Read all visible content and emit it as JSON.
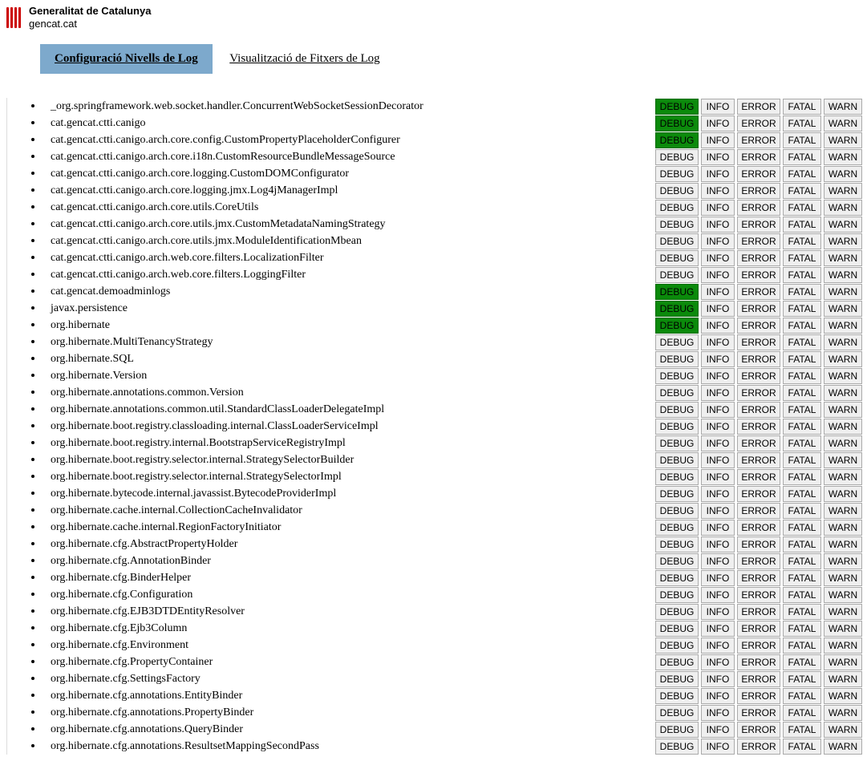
{
  "header": {
    "org_line1": "Generalitat de Catalunya",
    "org_line2": "gencat.cat"
  },
  "tabs": {
    "config": "Configuració Nivells de Log",
    "view": "Visualització de Fitxers de Log"
  },
  "levels": [
    "DEBUG",
    "INFO",
    "ERROR",
    "FATAL",
    "WARN"
  ],
  "loggers": [
    {
      "name": "_org.springframework.web.socket.handler.ConcurrentWebSocketSessionDecorator",
      "active": "DEBUG"
    },
    {
      "name": "cat.gencat.ctti.canigo",
      "active": "DEBUG"
    },
    {
      "name": "cat.gencat.ctti.canigo.arch.core.config.CustomPropertyPlaceholderConfigurer",
      "active": "DEBUG"
    },
    {
      "name": "cat.gencat.ctti.canigo.arch.core.i18n.CustomResourceBundleMessageSource",
      "active": null
    },
    {
      "name": "cat.gencat.ctti.canigo.arch.core.logging.CustomDOMConfigurator",
      "active": null
    },
    {
      "name": "cat.gencat.ctti.canigo.arch.core.logging.jmx.Log4jManagerImpl",
      "active": null
    },
    {
      "name": "cat.gencat.ctti.canigo.arch.core.utils.CoreUtils",
      "active": null
    },
    {
      "name": "cat.gencat.ctti.canigo.arch.core.utils.jmx.CustomMetadataNamingStrategy",
      "active": null
    },
    {
      "name": "cat.gencat.ctti.canigo.arch.core.utils.jmx.ModuleIdentificationMbean",
      "active": null
    },
    {
      "name": "cat.gencat.ctti.canigo.arch.web.core.filters.LocalizationFilter",
      "active": null
    },
    {
      "name": "cat.gencat.ctti.canigo.arch.web.core.filters.LoggingFilter",
      "active": null
    },
    {
      "name": "cat.gencat.demoadminlogs",
      "active": "DEBUG"
    },
    {
      "name": "javax.persistence",
      "active": "DEBUG"
    },
    {
      "name": "org.hibernate",
      "active": "DEBUG"
    },
    {
      "name": "org.hibernate.MultiTenancyStrategy",
      "active": null
    },
    {
      "name": "org.hibernate.SQL",
      "active": null
    },
    {
      "name": "org.hibernate.Version",
      "active": null
    },
    {
      "name": "org.hibernate.annotations.common.Version",
      "active": null
    },
    {
      "name": "org.hibernate.annotations.common.util.StandardClassLoaderDelegateImpl",
      "active": null
    },
    {
      "name": "org.hibernate.boot.registry.classloading.internal.ClassLoaderServiceImpl",
      "active": null
    },
    {
      "name": "org.hibernate.boot.registry.internal.BootstrapServiceRegistryImpl",
      "active": null
    },
    {
      "name": "org.hibernate.boot.registry.selector.internal.StrategySelectorBuilder",
      "active": null
    },
    {
      "name": "org.hibernate.boot.registry.selector.internal.StrategySelectorImpl",
      "active": null
    },
    {
      "name": "org.hibernate.bytecode.internal.javassist.BytecodeProviderImpl",
      "active": null
    },
    {
      "name": "org.hibernate.cache.internal.CollectionCacheInvalidator",
      "active": null
    },
    {
      "name": "org.hibernate.cache.internal.RegionFactoryInitiator",
      "active": null
    },
    {
      "name": "org.hibernate.cfg.AbstractPropertyHolder",
      "active": null
    },
    {
      "name": "org.hibernate.cfg.AnnotationBinder",
      "active": null
    },
    {
      "name": "org.hibernate.cfg.BinderHelper",
      "active": null
    },
    {
      "name": "org.hibernate.cfg.Configuration",
      "active": null
    },
    {
      "name": "org.hibernate.cfg.EJB3DTDEntityResolver",
      "active": null
    },
    {
      "name": "org.hibernate.cfg.Ejb3Column",
      "active": null
    },
    {
      "name": "org.hibernate.cfg.Environment",
      "active": null
    },
    {
      "name": "org.hibernate.cfg.PropertyContainer",
      "active": null
    },
    {
      "name": "org.hibernate.cfg.SettingsFactory",
      "active": null
    },
    {
      "name": "org.hibernate.cfg.annotations.EntityBinder",
      "active": null
    },
    {
      "name": "org.hibernate.cfg.annotations.PropertyBinder",
      "active": null
    },
    {
      "name": "org.hibernate.cfg.annotations.QueryBinder",
      "active": null
    },
    {
      "name": "org.hibernate.cfg.annotations.ResultsetMappingSecondPass",
      "active": null
    }
  ]
}
